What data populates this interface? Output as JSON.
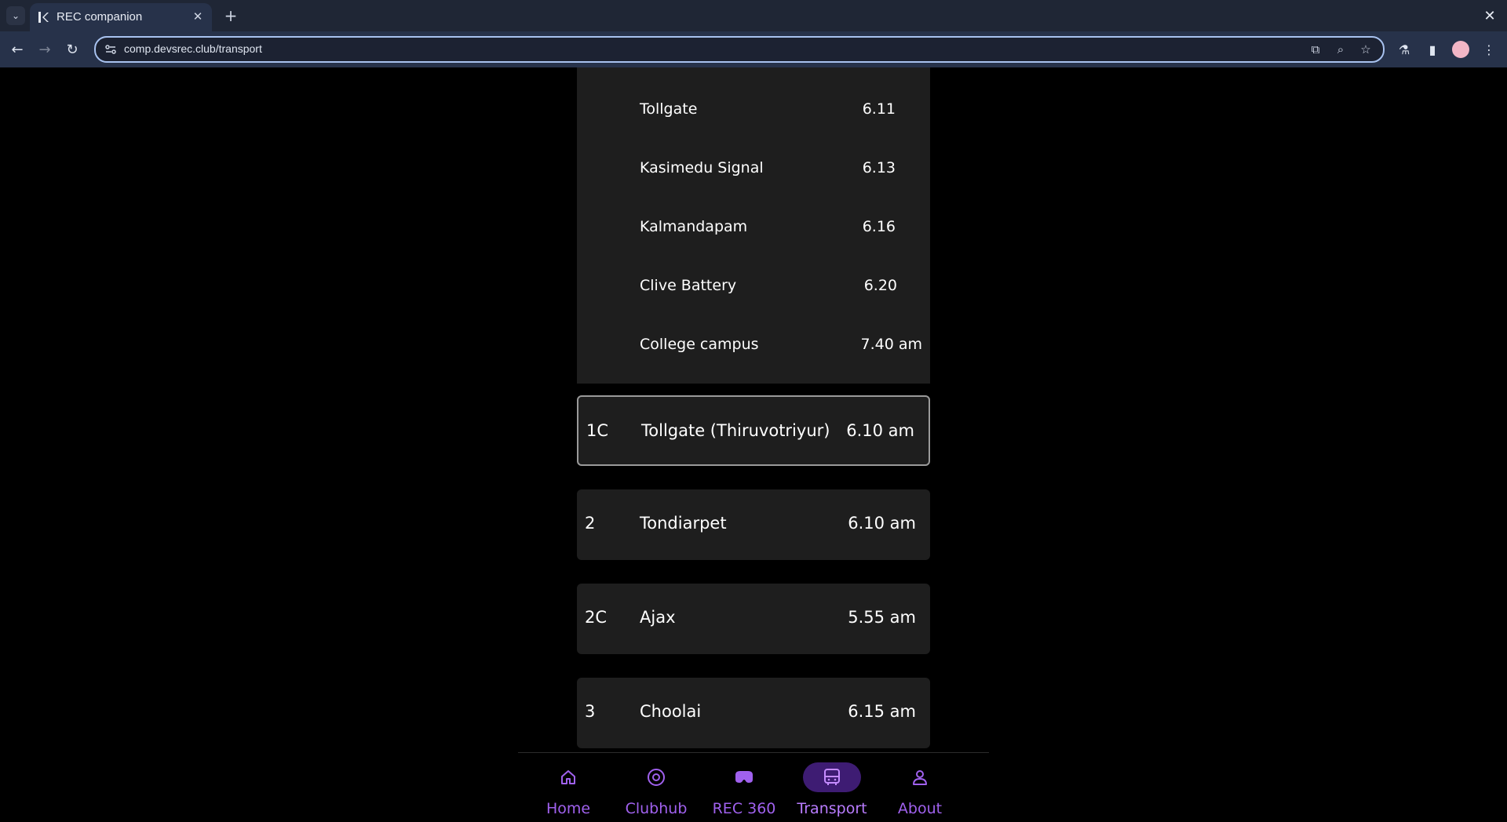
{
  "browser": {
    "tab_title": "REC companion",
    "url": "comp.devsrec.club/transport",
    "tab_dropdown_icon": "chevron-down-icon",
    "new_tab_symbol": "+",
    "close_symbol": "✕"
  },
  "stops": [
    {
      "name": "Tollgate",
      "time": "6.11"
    },
    {
      "name": "Kasimedu Signal",
      "time": "6.13"
    },
    {
      "name": "Kalmandapam",
      "time": "6.16"
    },
    {
      "name": "Clive Battery",
      "time": "6.20"
    },
    {
      "name": "College campus",
      "time": "7.40 am"
    }
  ],
  "routes": [
    {
      "no": "1C",
      "name": "Tollgate (Thiruvotriyur)",
      "time": "6.10 am",
      "selected": true
    },
    {
      "no": "2",
      "name": "Tondiarpet",
      "time": "6.10 am",
      "selected": false
    },
    {
      "no": "2C",
      "name": "Ajax",
      "time": "5.55 am",
      "selected": false
    },
    {
      "no": "3",
      "name": "Choolai",
      "time": "6.15 am",
      "selected": false
    }
  ],
  "bottom_nav": {
    "items": [
      {
        "label": "Home",
        "icon": "home-icon"
      },
      {
        "label": "Clubhub",
        "icon": "disc-icon"
      },
      {
        "label": "REC 360",
        "icon": "vr-headset-icon"
      },
      {
        "label": "Transport",
        "icon": "bus-icon",
        "active": true
      },
      {
        "label": "About",
        "icon": "user-icon"
      }
    ]
  },
  "colors": {
    "accent": "#a061ee",
    "active_pill": "#3e1c73",
    "card_bg": "#1e1e1e",
    "page_bg": "#000000"
  }
}
